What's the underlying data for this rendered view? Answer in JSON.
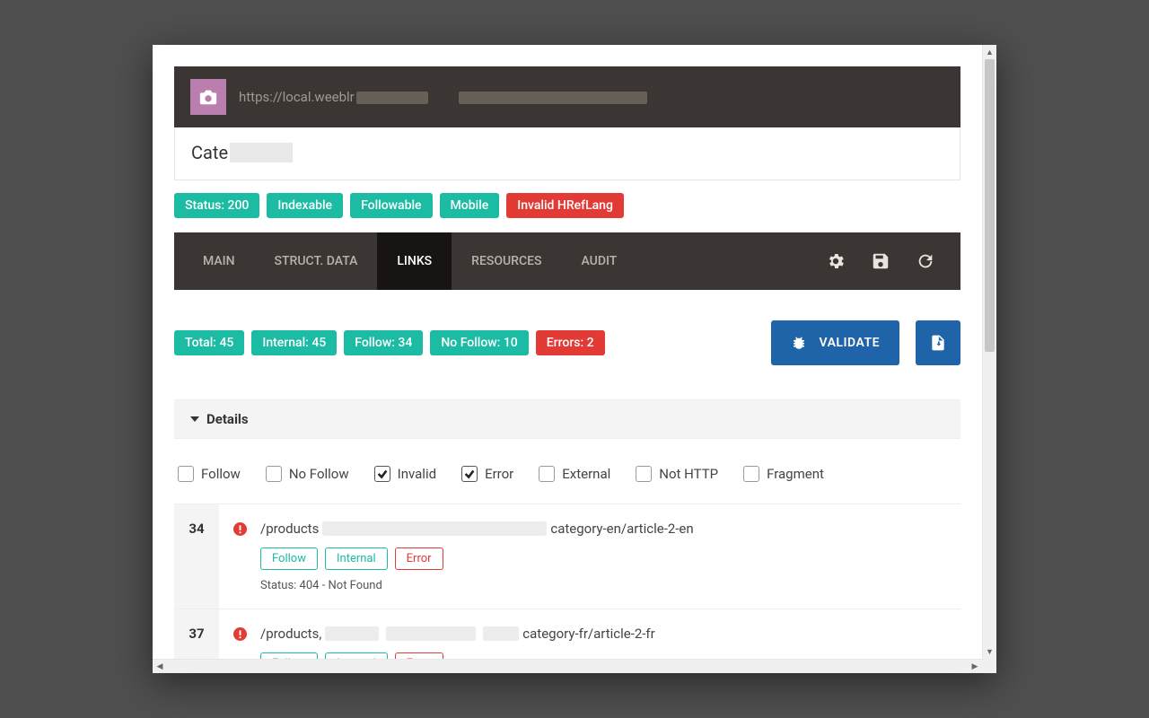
{
  "header": {
    "url_prefix": "https://local.weeblr"
  },
  "page": {
    "title_prefix": "Cate"
  },
  "status_chips": [
    {
      "text": "Status: 200",
      "style": "teal"
    },
    {
      "text": "Indexable",
      "style": "teal"
    },
    {
      "text": "Followable",
      "style": "teal"
    },
    {
      "text": "Mobile",
      "style": "teal"
    },
    {
      "text": "Invalid HRefLang",
      "style": "red"
    }
  ],
  "tabs": {
    "items": [
      "MAIN",
      "STRUCT. DATA",
      "LINKS",
      "RESOURCES",
      "AUDIT"
    ],
    "active_index": 2
  },
  "summary_chips": [
    {
      "text": "Total: 45",
      "style": "teal"
    },
    {
      "text": "Internal: 45",
      "style": "teal"
    },
    {
      "text": "Follow: 34",
      "style": "teal"
    },
    {
      "text": "No Follow: 10",
      "style": "teal"
    },
    {
      "text": "Errors: 2",
      "style": "red"
    }
  ],
  "validate_label": "VALIDATE",
  "details_label": "Details",
  "filters": [
    {
      "label": "Follow",
      "checked": false
    },
    {
      "label": "No Follow",
      "checked": false
    },
    {
      "label": "Invalid",
      "checked": true
    },
    {
      "label": "Error",
      "checked": true
    },
    {
      "label": "External",
      "checked": false
    },
    {
      "label": "Not HTTP",
      "checked": false
    },
    {
      "label": "Fragment",
      "checked": false
    }
  ],
  "rows": [
    {
      "idx": "34",
      "path_pre": "/products",
      "path_mid": "category-en/article-2-en",
      "tags": [
        {
          "text": "Follow",
          "style": "teal"
        },
        {
          "text": "Internal",
          "style": "teal"
        },
        {
          "text": "Error",
          "style": "red"
        }
      ],
      "status": "Status: 404 - Not Found"
    },
    {
      "idx": "37",
      "path_pre": "/products",
      "path_mid": "category-fr/article-2-fr",
      "tags": [
        {
          "text": "Follow",
          "style": "teal"
        },
        {
          "text": "Internal",
          "style": "teal"
        },
        {
          "text": "Error",
          "style": "red"
        }
      ],
      "status": ""
    }
  ]
}
